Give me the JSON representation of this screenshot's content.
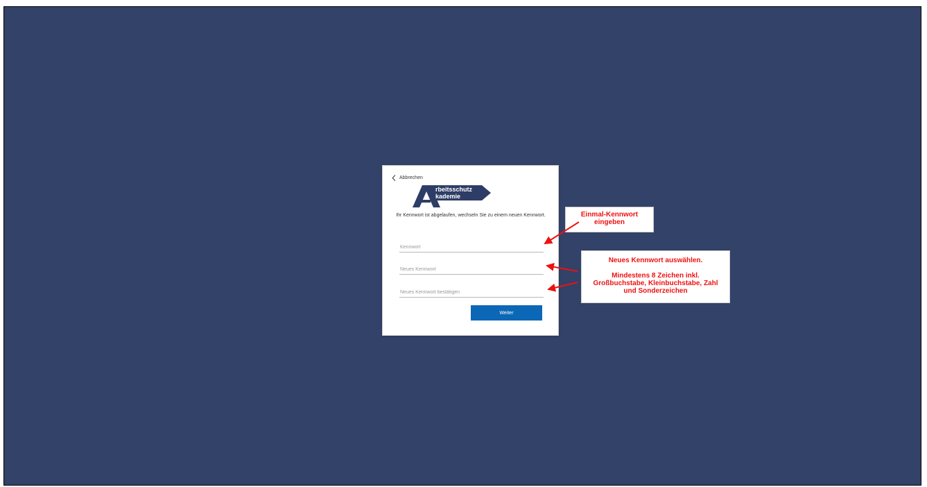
{
  "back": {
    "label": "Abbrechen"
  },
  "logo": {
    "letter": "A",
    "line1": "rbeitsschutz",
    "line2": "kademie"
  },
  "prompt": "Ihr Kennwort ist abgelaufen, wechseln Sie zu einem neuen Kennwort.",
  "fields": {
    "password_placeholder": "Kennwort",
    "new_password_placeholder": "Neues Kennwort",
    "confirm_password_placeholder": "Neues Kennwort bestätigen"
  },
  "submit_label": "Weiter",
  "annotations": {
    "note1_line1": "Einmal-Kennwort",
    "note1_line2": "eingeben",
    "note2_line1": "Neues Kennwort auswählen.",
    "note2_line2": "Mindestens 8 Zeichen inkl.",
    "note2_line3": "Großbuchstabe, Kleinbuchstabe, Zahl",
    "note2_line4": "und Sonderzeichen"
  },
  "colors": {
    "background": "#324268",
    "button": "#0c67b6",
    "annotation": "#ee1111",
    "logo": "#2e3d66"
  }
}
